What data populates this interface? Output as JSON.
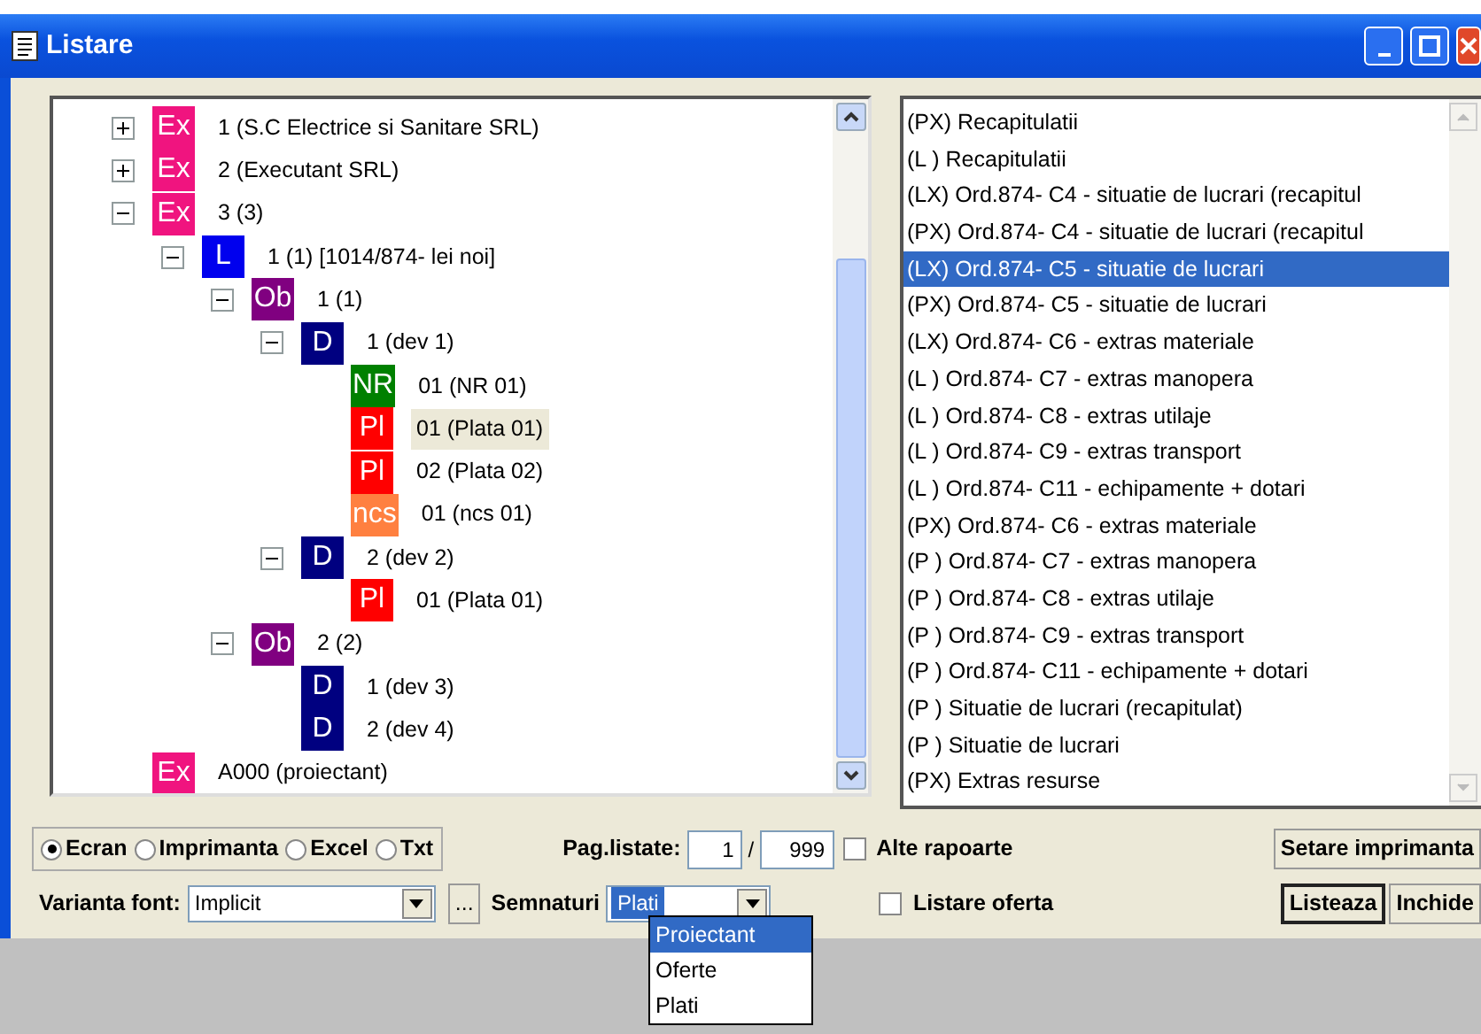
{
  "window": {
    "title": "Listare"
  },
  "tree": {
    "nodes": [
      {
        "tag": "Ex",
        "color": "#f0147f",
        "label": "1 (S.C Electrice si Sanitare SRL)",
        "expanded": false,
        "selected": false
      },
      {
        "tag": "Ex",
        "color": "#f0147f",
        "label": "2 (Executant SRL)",
        "expanded": false,
        "selected": false
      },
      {
        "tag": "Ex",
        "color": "#f0147f",
        "label": "3 (3)",
        "expanded": true,
        "selected": false,
        "children": [
          {
            "tag": "L",
            "color": "#0000ee",
            "label": "1 (1) [1014/874- lei noi]",
            "expanded": true,
            "selected": false,
            "children": [
              {
                "tag": "Ob",
                "color": "#800080",
                "label": "1 (1)",
                "expanded": true,
                "selected": false,
                "children": [
                  {
                    "tag": "D",
                    "color": "#000080",
                    "label": "1 (dev 1)",
                    "expanded": true,
                    "selected": false,
                    "children": [
                      {
                        "tag": "NR",
                        "color": "#008000",
                        "label": "01 (NR 01)",
                        "selected": false
                      },
                      {
                        "tag": "Pl",
                        "color": "#ff0000",
                        "label": "01 (Plata 01)",
                        "selected": true
                      },
                      {
                        "tag": "Pl",
                        "color": "#ff0000",
                        "label": "02 (Plata 02)",
                        "selected": false
                      },
                      {
                        "tag": "ncs",
                        "color": "#ff8040",
                        "label": "01 (ncs 01)",
                        "selected": false
                      }
                    ]
                  },
                  {
                    "tag": "D",
                    "color": "#000080",
                    "label": "2 (dev 2)",
                    "expanded": true,
                    "selected": false,
                    "children": [
                      {
                        "tag": "Pl",
                        "color": "#ff0000",
                        "label": "01 (Plata 01)",
                        "selected": false
                      }
                    ]
                  }
                ]
              },
              {
                "tag": "Ob",
                "color": "#800080",
                "label": "2 (2)",
                "expanded": true,
                "selected": false,
                "children": [
                  {
                    "tag": "D",
                    "color": "#000080",
                    "label": "1 (dev 3)",
                    "selected": false
                  },
                  {
                    "tag": "D",
                    "color": "#000080",
                    "label": "2 (dev 4)",
                    "selected": false
                  }
                ]
              }
            ]
          }
        ]
      },
      {
        "tag": "Ex",
        "color": "#f0147f",
        "label": "A000 (proiectant)",
        "selected": false
      }
    ]
  },
  "report_list": {
    "items": [
      {
        "text": "(PX) Recapitulatii",
        "selected": false
      },
      {
        "text": "(L ) Recapitulatii",
        "selected": false
      },
      {
        "text": "(LX) Ord.874- C4 - situatie de lucrari (recapitul",
        "selected": false
      },
      {
        "text": "(PX) Ord.874- C4 - situatie de lucrari (recapitul",
        "selected": false
      },
      {
        "text": "(LX) Ord.874- C5 - situatie de lucrari",
        "selected": true
      },
      {
        "text": "(PX) Ord.874- C5 - situatie de lucrari",
        "selected": false
      },
      {
        "text": "(LX) Ord.874- C6 - extras materiale",
        "selected": false
      },
      {
        "text": "(L ) Ord.874- C7 - extras manopera",
        "selected": false
      },
      {
        "text": "(L ) Ord.874- C8 - extras utilaje",
        "selected": false
      },
      {
        "text": "(L ) Ord.874- C9 - extras transport",
        "selected": false
      },
      {
        "text": "(L ) Ord.874- C11 - echipamente + dotari",
        "selected": false
      },
      {
        "text": "(PX) Ord.874- C6 - extras materiale",
        "selected": false
      },
      {
        "text": "(P ) Ord.874- C7 - extras manopera",
        "selected": false
      },
      {
        "text": "(P ) Ord.874- C8 - extras utilaje",
        "selected": false
      },
      {
        "text": "(P ) Ord.874- C9 - extras transport",
        "selected": false
      },
      {
        "text": "(P ) Ord.874- C11 - echipamente + dotari",
        "selected": false
      },
      {
        "text": "(P ) Situatie de lucrari (recapitulat)",
        "selected": false
      },
      {
        "text": "(P ) Situatie de lucrari",
        "selected": false
      },
      {
        "text": "(PX) Extras resurse",
        "selected": false
      }
    ]
  },
  "output": {
    "options": [
      {
        "label": "Ecran",
        "selected": true
      },
      {
        "label": "Imprimanta",
        "selected": false
      },
      {
        "label": "Excel",
        "selected": false
      },
      {
        "label": "Txt",
        "selected": false
      }
    ]
  },
  "pages": {
    "label": "Pag.listate:",
    "from": "1",
    "separator": "/",
    "to": "999"
  },
  "checkboxes": [
    {
      "label": "Alte rapoarte",
      "checked": false
    },
    {
      "label": "Listare oferta",
      "checked": false
    }
  ],
  "font_variant": {
    "label": "Varianta font:",
    "value": "Implicit",
    "browse": "..."
  },
  "signatures": {
    "label": "Semnaturi",
    "value": "Plati",
    "expanded": true,
    "options": [
      {
        "label": "Proiectant",
        "highlighted": true
      },
      {
        "label": "Oferte",
        "highlighted": false
      },
      {
        "label": "Plati",
        "highlighted": false
      }
    ]
  },
  "buttons": [
    {
      "label": "Setare imprimanta",
      "default": false
    },
    {
      "label": "Listeaza",
      "default": true
    },
    {
      "label": "Inchide",
      "default": false
    }
  ]
}
